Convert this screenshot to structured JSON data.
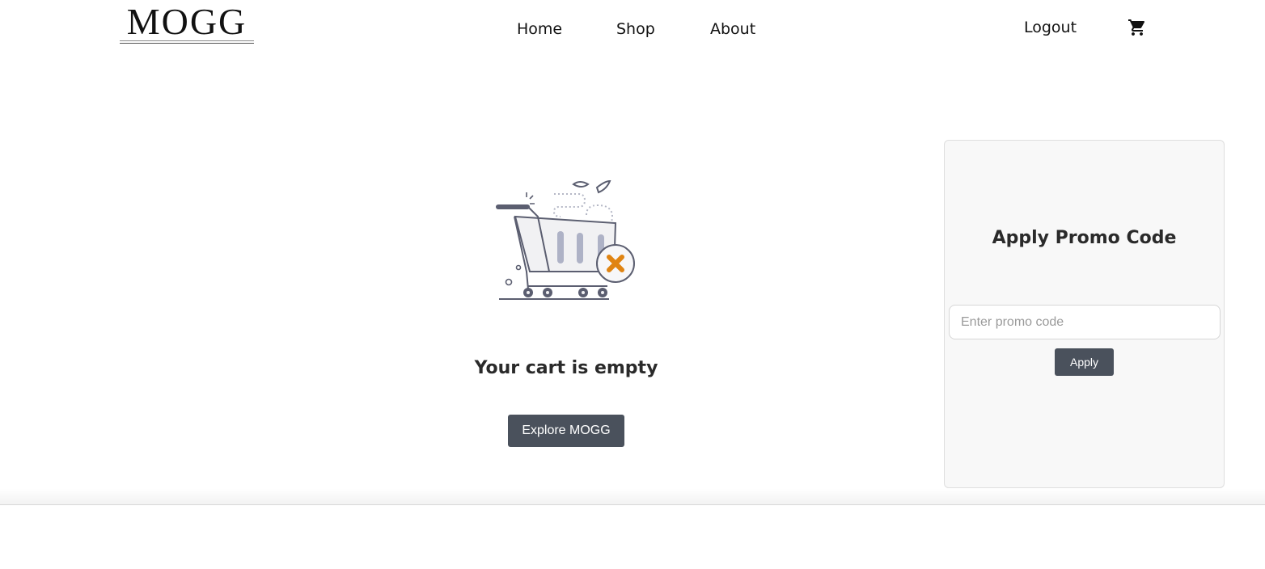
{
  "header": {
    "logo": "MOGG",
    "nav": [
      {
        "label": "Home"
      },
      {
        "label": "Shop"
      },
      {
        "label": "About"
      }
    ],
    "logout_label": "Logout",
    "cart_icon": "shopping-cart-icon"
  },
  "main": {
    "empty_message": "Your cart is empty",
    "explore_label": "Explore MOGG",
    "illustration_icon": "empty-cart-illustration",
    "accent_color": "#e08412"
  },
  "promo": {
    "title": "Apply Promo Code",
    "placeholder": "Enter promo code",
    "value": "",
    "apply_label": "Apply"
  },
  "colors": {
    "button_bg": "#4a515c",
    "card_bg": "#f8f8f8"
  }
}
